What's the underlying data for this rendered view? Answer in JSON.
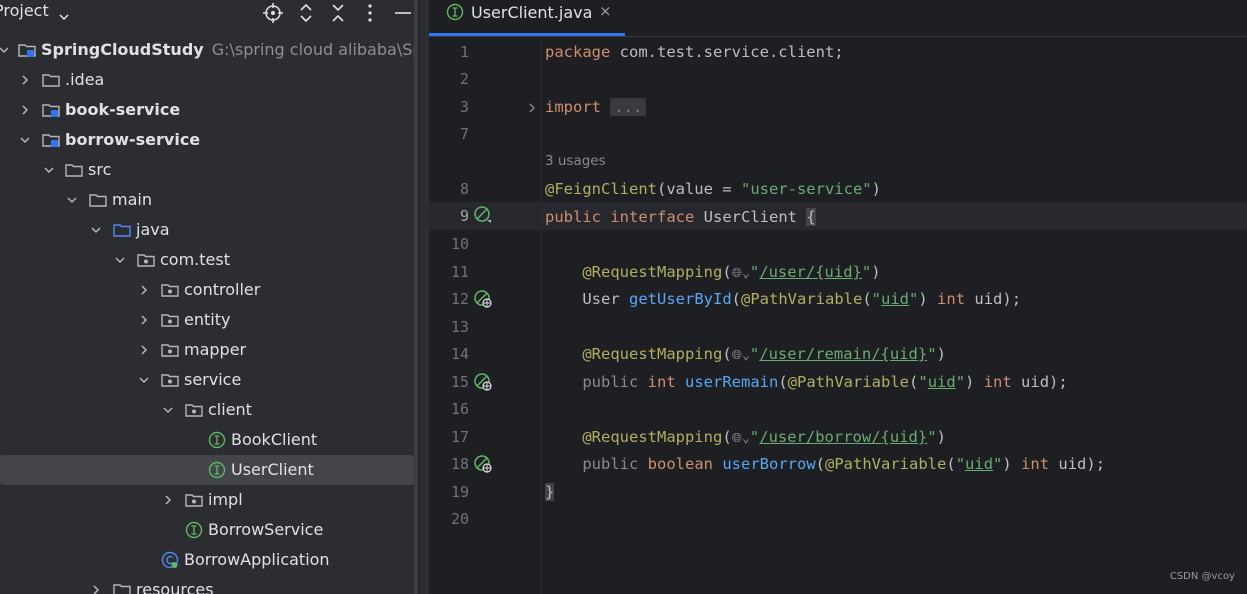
{
  "project_panel": {
    "title": "Project",
    "tree": [
      {
        "label": "SpringCloudStudy",
        "path": "G:\\spring cloud alibaba\\Sprin",
        "bold": true
      },
      {
        "label": ".idea"
      },
      {
        "label": "book-service",
        "bold": true
      },
      {
        "label": "borrow-service",
        "bold": true
      },
      {
        "label": "src"
      },
      {
        "label": "main"
      },
      {
        "label": "java"
      },
      {
        "label": "com.test"
      },
      {
        "label": "controller"
      },
      {
        "label": "entity"
      },
      {
        "label": "mapper"
      },
      {
        "label": "service"
      },
      {
        "label": "client"
      },
      {
        "label": "BookClient"
      },
      {
        "label": "UserClient"
      },
      {
        "label": "impl"
      },
      {
        "label": "BorrowService"
      },
      {
        "label": "BorrowApplication"
      },
      {
        "label": "resources"
      }
    ]
  },
  "editor": {
    "tab_label": "UserClient.java",
    "tab_close": "×",
    "line_numbers": [
      "1",
      "2",
      "3",
      "7",
      "8",
      "9",
      "10",
      "11",
      "12",
      "13",
      "14",
      "15",
      "16",
      "17",
      "18",
      "19",
      "20"
    ],
    "usages_hint": "3 usages",
    "code": {
      "l1_kw": "package",
      "l1_rest": " com.test.service.client;",
      "l3_kw": "import",
      "l3_fold": "...",
      "l8_ann": "@FeignClient",
      "l8_open": "(value = ",
      "l8_str": "\"user-service\"",
      "l8_close": ")",
      "l9_kw1": "public",
      "l9_kw2": "interface",
      "l9_name": " UserClient ",
      "l9_brace": "{",
      "rm": "@RequestMapping",
      "globe": "🌐︎⌄",
      "q": "\"",
      "path1": "/user/{uid}",
      "path2": "/user/remain/{uid}",
      "path3": "/user/borrow/{uid}",
      "pv": "@PathVariable",
      "uid": "uid",
      "kw_public": "public",
      "kw_int": "int",
      "kw_boolean": "boolean",
      "type_user": "User",
      "m1": "getUserById",
      "m2": "userRemain",
      "m3": "userBorrow",
      "param": " uid);",
      "close_brace": "}"
    }
  },
  "watermark": "CSDN @vcoy"
}
